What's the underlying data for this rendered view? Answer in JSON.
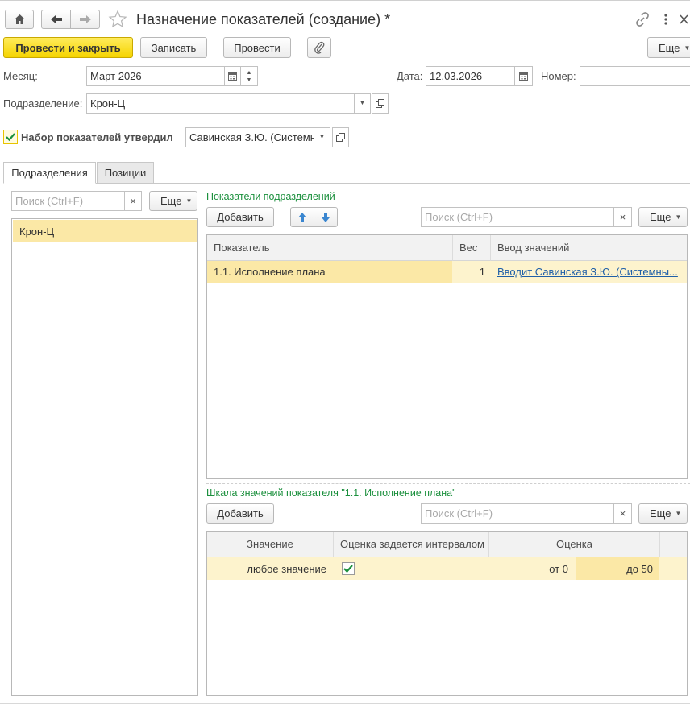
{
  "header": {
    "title": "Назначение показателей (создание) *"
  },
  "toolbar": {
    "post_and_close": "Провести и закрыть",
    "save": "Записать",
    "post": "Провести",
    "more": "Еще"
  },
  "form": {
    "month_label": "Месяц:",
    "month_value": "Март 2026",
    "date_label": "Дата:",
    "date_value": "12.03.2026",
    "number_label": "Номер:",
    "number_value": "",
    "division_label": "Подразделение:",
    "division_value": "Крон-Ц",
    "approved_label": "Набор показателей утвердил",
    "approved_checked": true,
    "approved_value": "Савинская З.Ю. (Системн"
  },
  "tabs": [
    {
      "label": "Подразделения",
      "active": true
    },
    {
      "label": "Позиции",
      "active": false
    }
  ],
  "left_panel": {
    "search_placeholder": "Поиск (Ctrl+F)",
    "more": "Еще",
    "items": [
      "Крон-Ц"
    ]
  },
  "indicators": {
    "section_title": "Показатели подразделений",
    "add": "Добавить",
    "search_placeholder": "Поиск (Ctrl+F)",
    "more": "Еще",
    "columns": [
      "Показатель",
      "Вес",
      "Ввод значений"
    ],
    "rows": [
      {
        "indicator": "1.1. Исполнение плана",
        "weight": "1",
        "input": "Вводит Савинская З.Ю. (Системны..."
      }
    ]
  },
  "scale": {
    "section_title": "Шкала значений показателя \"1.1. Исполнение плана\"",
    "add": "Добавить",
    "search_placeholder": "Поиск (Ctrl+F)",
    "more": "Еще",
    "columns": [
      "Значение",
      "Оценка задается интервалом",
      "Оценка"
    ],
    "rows": [
      {
        "value": "любое значение",
        "interval": true,
        "from": "от 0",
        "to": "до 50"
      }
    ]
  },
  "colors": {
    "accent_yellow": "#f5d400",
    "selected_row": "#fbe8a6",
    "section_title": "#1a8f3c",
    "link": "#1f5fa8"
  }
}
